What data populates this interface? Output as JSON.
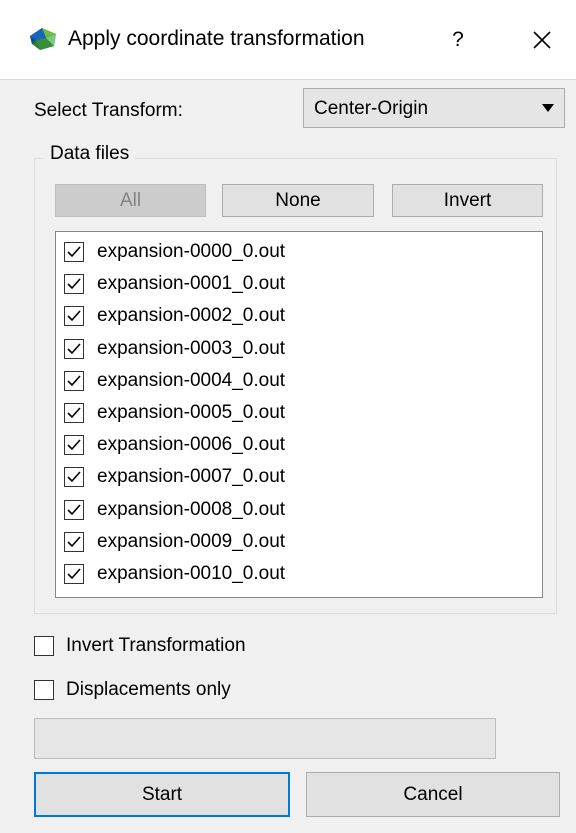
{
  "window": {
    "title": "Apply coordinate transformation",
    "help_label": "?",
    "app_icon": "colorful-mesh-icon",
    "close_icon": "close-icon"
  },
  "transform": {
    "label": "Select Transform:",
    "selected": "Center-Origin"
  },
  "data_files": {
    "group_title": "Data files",
    "buttons": {
      "all": "All",
      "none": "None",
      "invert": "Invert"
    },
    "all_disabled": true,
    "items": [
      {
        "label": "expansion-0000_0.out",
        "checked": true
      },
      {
        "label": "expansion-0001_0.out",
        "checked": true
      },
      {
        "label": "expansion-0002_0.out",
        "checked": true
      },
      {
        "label": "expansion-0003_0.out",
        "checked": true
      },
      {
        "label": "expansion-0004_0.out",
        "checked": true
      },
      {
        "label": "expansion-0005_0.out",
        "checked": true
      },
      {
        "label": "expansion-0006_0.out",
        "checked": true
      },
      {
        "label": "expansion-0007_0.out",
        "checked": true
      },
      {
        "label": "expansion-0008_0.out",
        "checked": true
      },
      {
        "label": "expansion-0009_0.out",
        "checked": true
      },
      {
        "label": "expansion-0010_0.out",
        "checked": true
      }
    ]
  },
  "options": {
    "invert_transformation": {
      "label": "Invert Transformation",
      "checked": false
    },
    "displacements_only": {
      "label": "Displacements only",
      "checked": false
    }
  },
  "progress": {
    "value": 0
  },
  "actions": {
    "start": "Start",
    "cancel": "Cancel"
  },
  "colors": {
    "focus_border": "#0078d7",
    "window_bg": "#f0f0f0"
  }
}
